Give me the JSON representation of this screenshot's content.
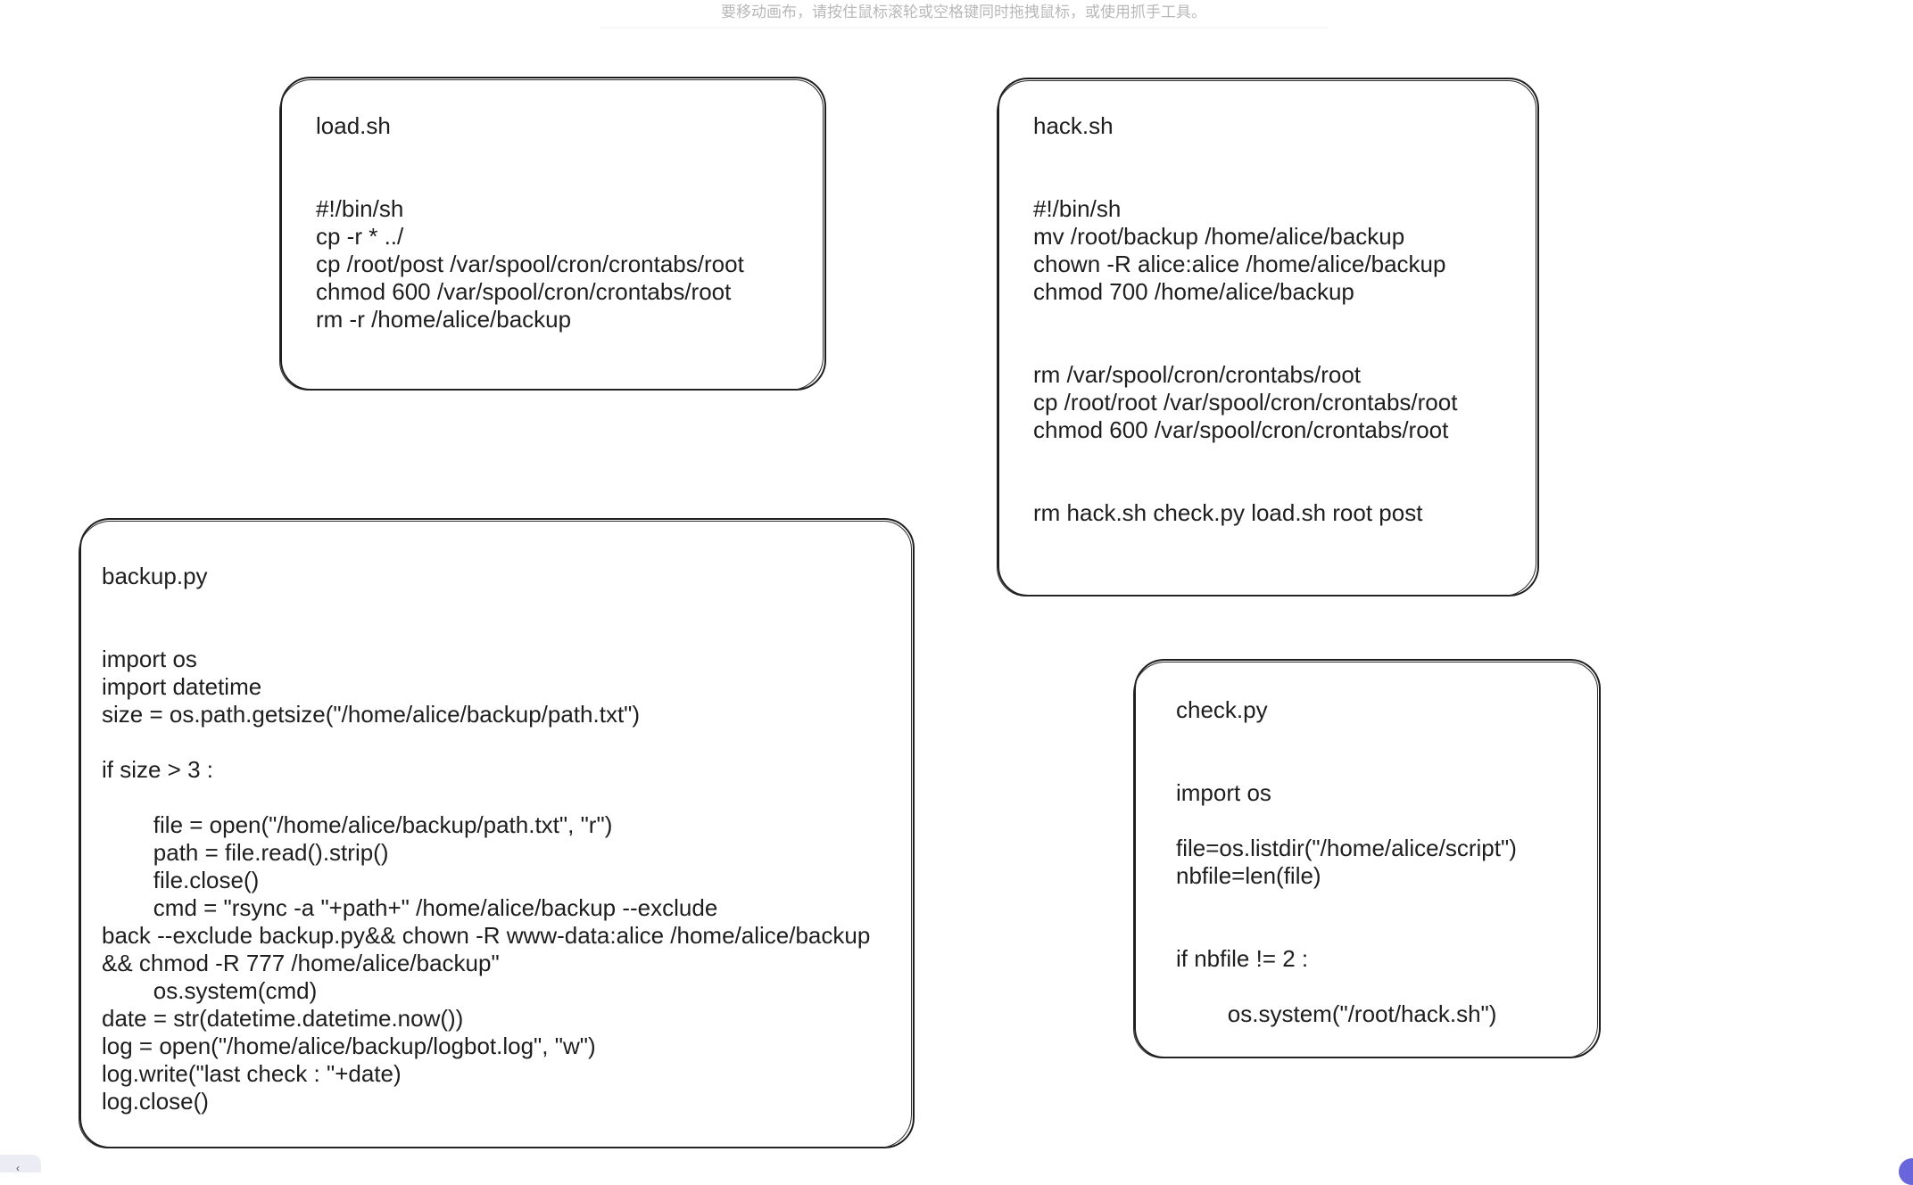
{
  "canvas": {
    "hint": "要移动画布，请按住鼠标滚轮或空格键同时拖拽鼠标，或使用抓手工具。"
  },
  "notes": {
    "load_sh": {
      "text": "load.sh\n\n\n#!/bin/sh\ncp -r * ../\ncp /root/post /var/spool/cron/crontabs/root\nchmod 600 /var/spool/cron/crontabs/root\nrm -r /home/alice/backup"
    },
    "hack_sh": {
      "text": "hack.sh\n\n\n#!/bin/sh\nmv /root/backup /home/alice/backup\nchown -R alice:alice /home/alice/backup\nchmod 700 /home/alice/backup\n\n\nrm /var/spool/cron/crontabs/root\ncp /root/root /var/spool/cron/crontabs/root\nchmod 600 /var/spool/cron/crontabs/root\n\n\nrm hack.sh check.py load.sh root post"
    },
    "backup_py": {
      "text": "backup.py\n\n\nimport os\nimport datetime\nsize = os.path.getsize(\"/home/alice/backup/path.txt\")\n\nif size > 3 :\n\n        file = open(\"/home/alice/backup/path.txt\", \"r\")\n        path = file.read().strip()\n        file.close()\n        cmd = \"rsync -a \"+path+\" /home/alice/backup --exclude\nback --exclude backup.py&& chown -R www-data:alice /home/alice/backup\n&& chmod -R 777 /home/alice/backup\"\n        os.system(cmd)\ndate = str(datetime.datetime.now())\nlog = open(\"/home/alice/backup/logbot.log\", \"w\")\nlog.write(\"last check : \"+date)\nlog.close()"
    },
    "check_py": {
      "text": "check.py\n\n\nimport os\n\nfile=os.listdir(\"/home/alice/script\")\nnbfile=len(file)\n\n\nif nbfile != 2 :\n\n        os.system(\"/root/hack.sh\")"
    }
  },
  "colors": {
    "stroke": "#1e1e1e",
    "background": "#ffffff",
    "hint_text": "#b8b8b8",
    "accent": "#6965db"
  }
}
